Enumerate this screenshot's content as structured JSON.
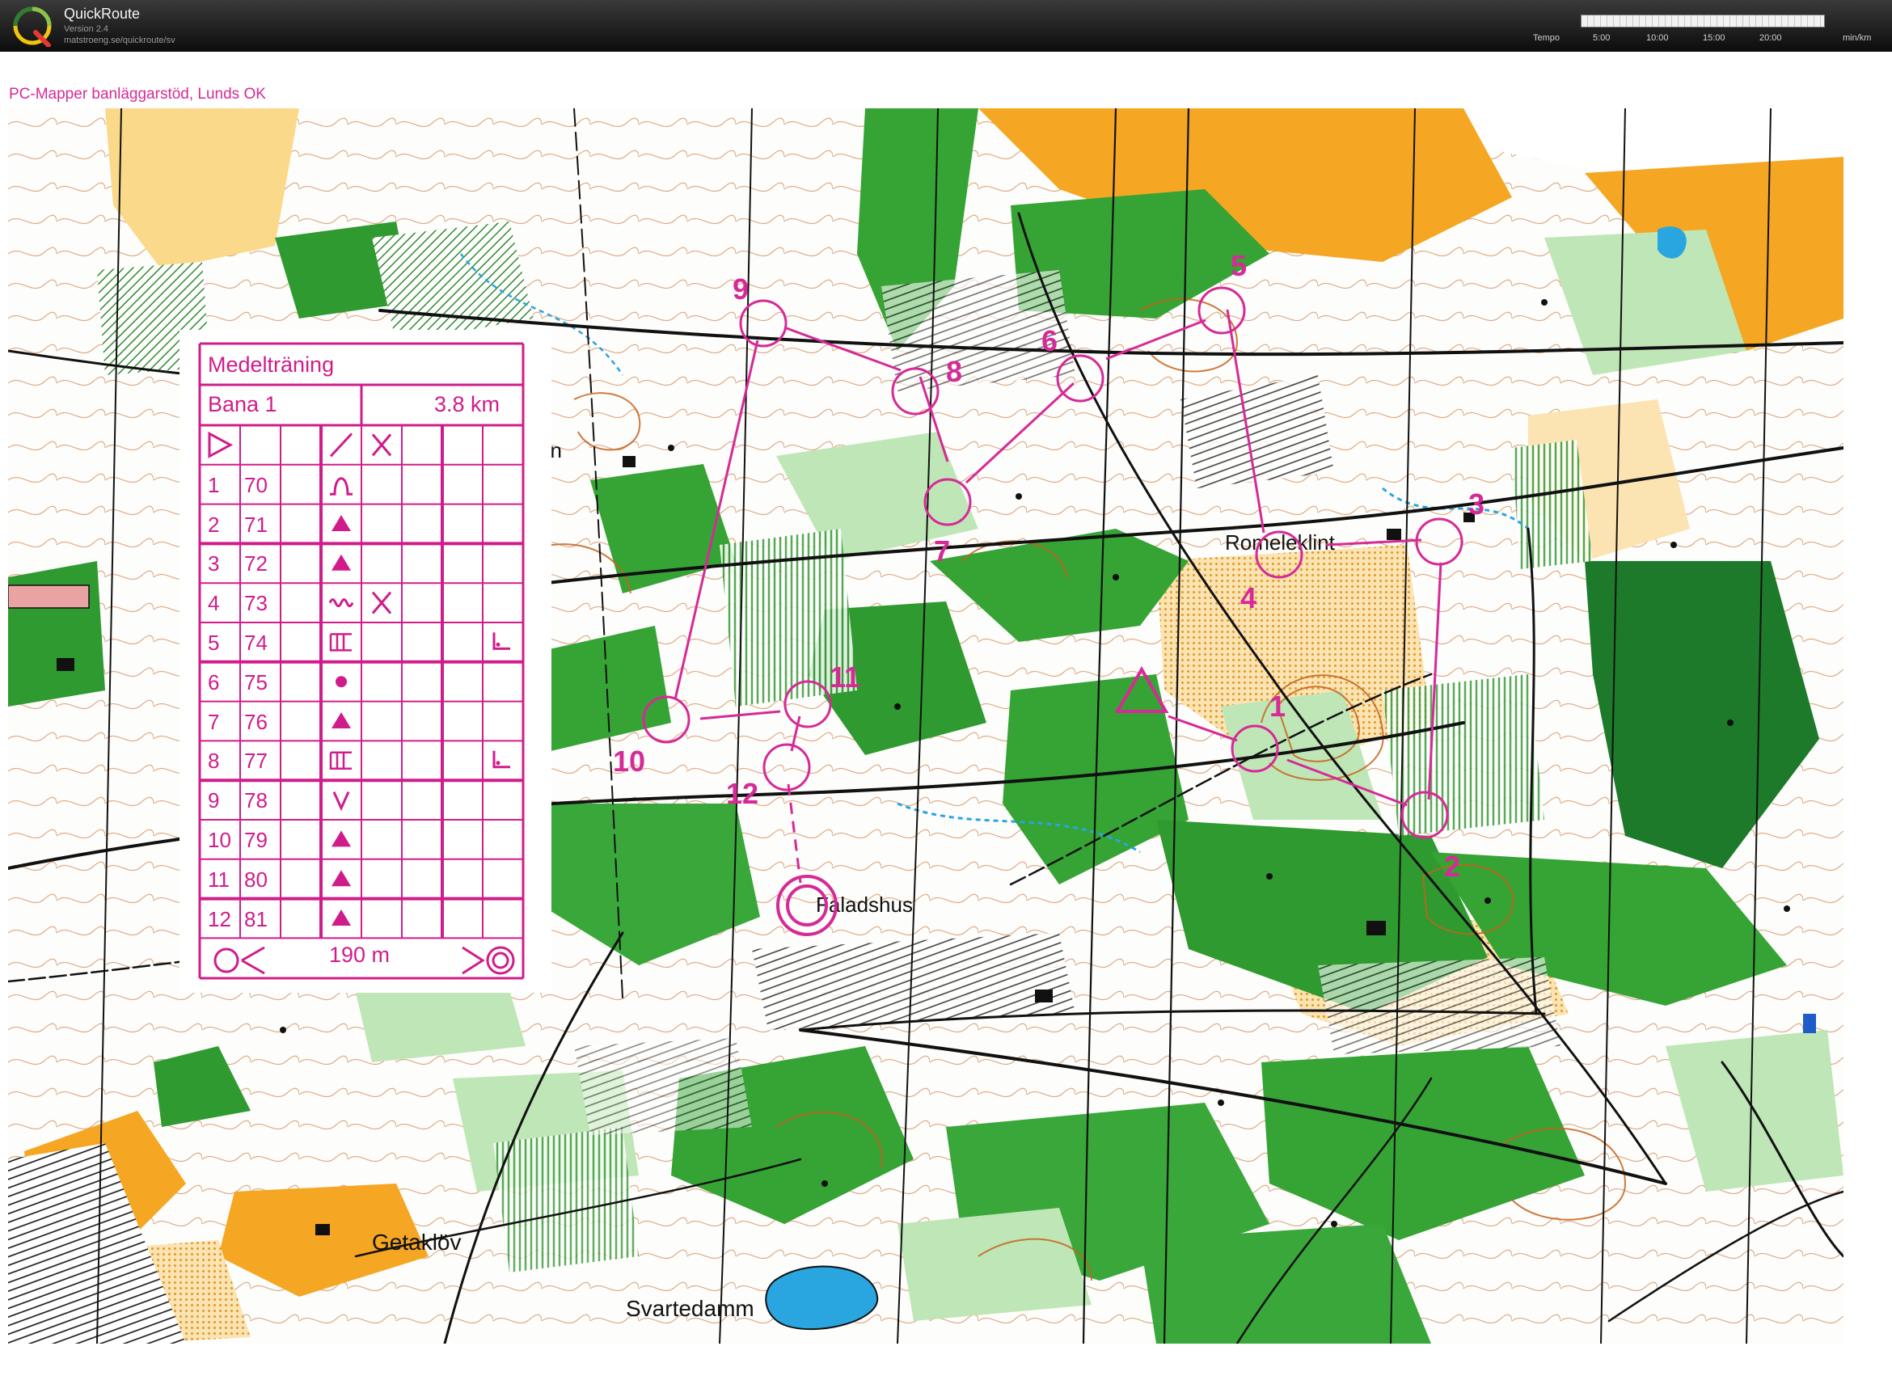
{
  "app": {
    "title": "QuickRoute",
    "version": "Version 2.4",
    "url": "matstroeng.se/quickroute/sv",
    "logo_letter": "Q"
  },
  "pace_scale": {
    "label": "Tempo",
    "ticks": [
      "5:00",
      "10:00",
      "15:00",
      "20:00"
    ],
    "unit": "min/km"
  },
  "map": {
    "header": "PC-Mapper banläggarstöd, Lunds OK",
    "course_color": "#d62a97",
    "place_names": {
      "romeleklint": "Romeleklint",
      "faladshus": "Faladshus",
      "getaklov": "Getaklöv",
      "svartedamm": "Svartedamm",
      "an": "an"
    },
    "control_numbers": [
      "1",
      "2",
      "3",
      "4",
      "5",
      "6",
      "7",
      "8",
      "9",
      "10",
      "11",
      "12"
    ]
  },
  "legend": {
    "title": "Medelträning",
    "course": "Bana 1",
    "length": "3.8 km",
    "rows": [
      {
        "num": "1",
        "code": "70",
        "symbol": "knoll"
      },
      {
        "num": "2",
        "code": "71",
        "symbol": "triangle"
      },
      {
        "num": "3",
        "code": "72",
        "symbol": "triangle"
      },
      {
        "num": "4",
        "code": "73",
        "symbol": "wiggle",
        "extra": "cross"
      },
      {
        "num": "5",
        "code": "74",
        "symbol": "cliff",
        "position": "corner"
      },
      {
        "num": "6",
        "code": "75",
        "symbol": "dot"
      },
      {
        "num": "7",
        "code": "76",
        "symbol": "triangle"
      },
      {
        "num": "8",
        "code": "77",
        "symbol": "cliff",
        "position": "corner"
      },
      {
        "num": "9",
        "code": "78",
        "symbol": "v"
      },
      {
        "num": "10",
        "code": "79",
        "symbol": "triangle"
      },
      {
        "num": "11",
        "code": "80",
        "symbol": "triangle"
      },
      {
        "num": "12",
        "code": "81",
        "symbol": "triangle"
      }
    ],
    "finish_distance": "190 m"
  }
}
